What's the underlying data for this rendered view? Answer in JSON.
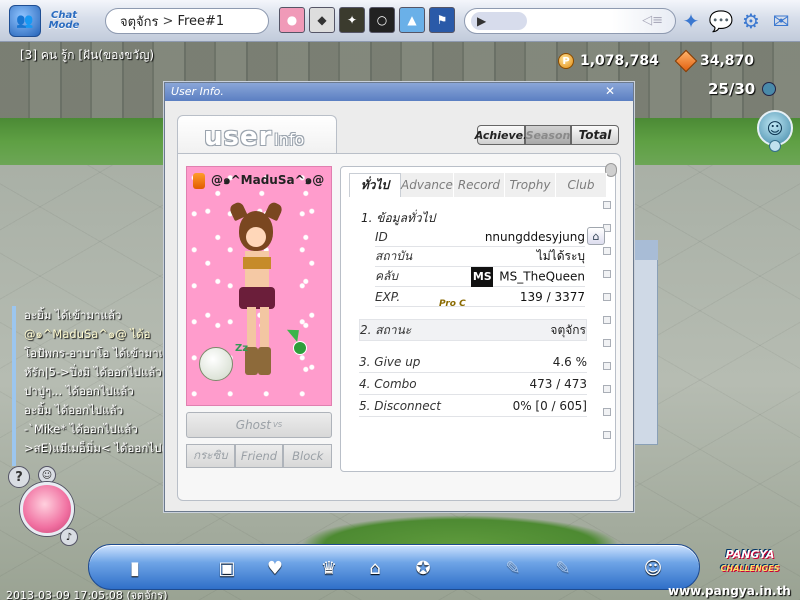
{
  "topbar": {
    "chat_mode": "Chat Mode",
    "room_name": "จตุจักร",
    "room_sep": ">",
    "channel": "Free#1",
    "chat_prefix": "▶",
    "avatar_icons": [
      "pink-char-icon",
      "cat-char-icon",
      "dark-char-icon",
      "ball-char-icon",
      "blue-fox-icon",
      "flag-icon"
    ]
  },
  "status": {
    "room_line": "[3] คน รู้ก [ฝัน(ของขวัญ)"
  },
  "currency": {
    "pang": "1,078,784",
    "cookie": "34,870"
  },
  "players": "25/30",
  "chat": {
    "lines": [
      "อะยิ้ม ได้เข้ามาแล้ว",
      "@๑^MaduSa^๑@ ได้อ",
      "โอปัพกร-อาบาโอ ได้เข้ามาแล้",
      "หัรัก|5->ปิ่งมิ ได้ออกไปแล้ว",
      "ปาปู่ๆ... ได้ออกไปแล้ว",
      "อะยิ้ม ได้ออกไปแล้ว",
      "-ˋMike* ได้ออกไปแล้ว",
      ">สE)แมีเมอ็มิ่ม< ได้ออกไปแ"
    ]
  },
  "window": {
    "title": "User Info.",
    "logo_user": "user",
    "logo_info": "Info",
    "seg": {
      "achieve": "Achieve.",
      "season": "Season",
      "total": "Total"
    },
    "profile": {
      "name": "@๑^MaduSa^๑@",
      "ghost_label": "Ghost",
      "ghost_vs": "VS",
      "buttons": [
        "กระซิบ",
        "Friend",
        "Block"
      ]
    },
    "tabs": [
      "ทั่วไป",
      "Advance",
      "Record",
      "Trophy",
      "Club"
    ],
    "general": {
      "heading": "1. ข้อมูลทั่วไป",
      "rows": [
        {
          "k": "ID",
          "v": "nnungddesyjung"
        },
        {
          "k": "สถาบัน",
          "v": "ไม่ได้ระบุ"
        },
        {
          "k": "คลับ",
          "v": "MS_TheQueen"
        },
        {
          "k": "EXP.",
          "v": "139 / 3377"
        }
      ],
      "club_logo": "MS",
      "rank": "Pro C"
    },
    "status_row": {
      "k": "2. สถานะ",
      "v": "จตุจักร"
    },
    "stat_rows": [
      {
        "k": "3. Give up",
        "v": "4.6 %"
      },
      {
        "k": "4. Combo",
        "v": "473 / 473"
      },
      {
        "k": "5. Disconnect",
        "v": "0% [0 / 605]"
      }
    ]
  },
  "footer": {
    "timestamp": "2013-03-09 17:05:08 (จตุจักร)",
    "brand_top": "PANGYA",
    "brand_bottom": "CHALLENGES",
    "site": "www.pangya.in.th"
  }
}
